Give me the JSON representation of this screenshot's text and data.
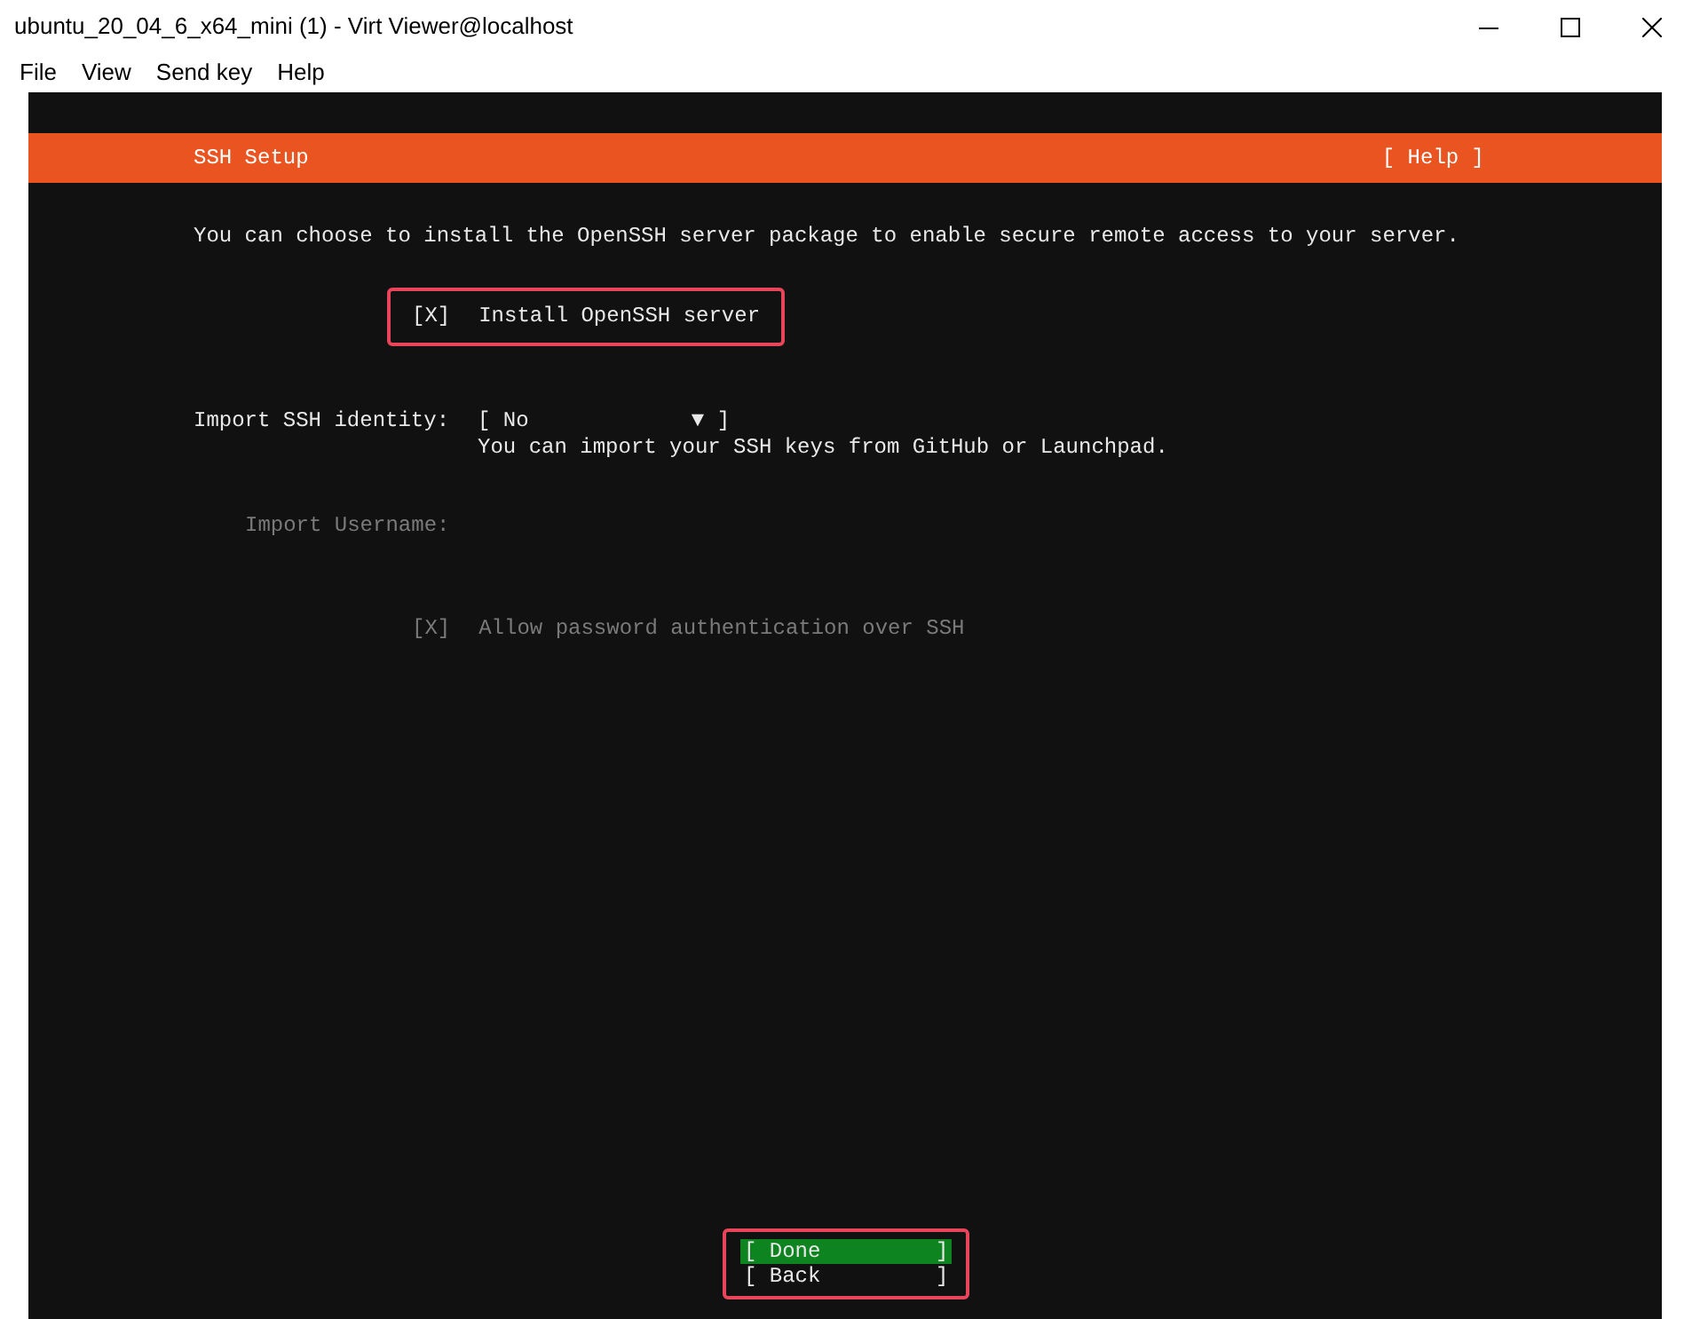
{
  "window": {
    "title": "ubuntu_20_04_6_x64_mini (1) - Virt Viewer@localhost"
  },
  "menu": [
    "File",
    "View",
    "Send key",
    "Help"
  ],
  "header": {
    "title": "SSH Setup",
    "help": "[ Help ]"
  },
  "intro": "You can choose to install the OpenSSH server package to enable secure remote access to your server.",
  "install": {
    "box": "[X]",
    "checked": true,
    "label": "Install OpenSSH server",
    "highlighted": true
  },
  "identity": {
    "label": "Import SSH identity:",
    "value": "[ No",
    "arrow": "▼ ]",
    "hint": "You can import your SSH keys from GitHub or Launchpad."
  },
  "username": {
    "label": "Import Username:",
    "disabled": true
  },
  "password": {
    "box": "[X]",
    "checked": true,
    "label": "Allow password authentication over SSH",
    "disabled": true
  },
  "buttons": [
    {
      "label": "[ Done         ]",
      "selected": true
    },
    {
      "label": "[ Back         ]",
      "selected": false
    }
  ],
  "buttons_highlighted": true
}
